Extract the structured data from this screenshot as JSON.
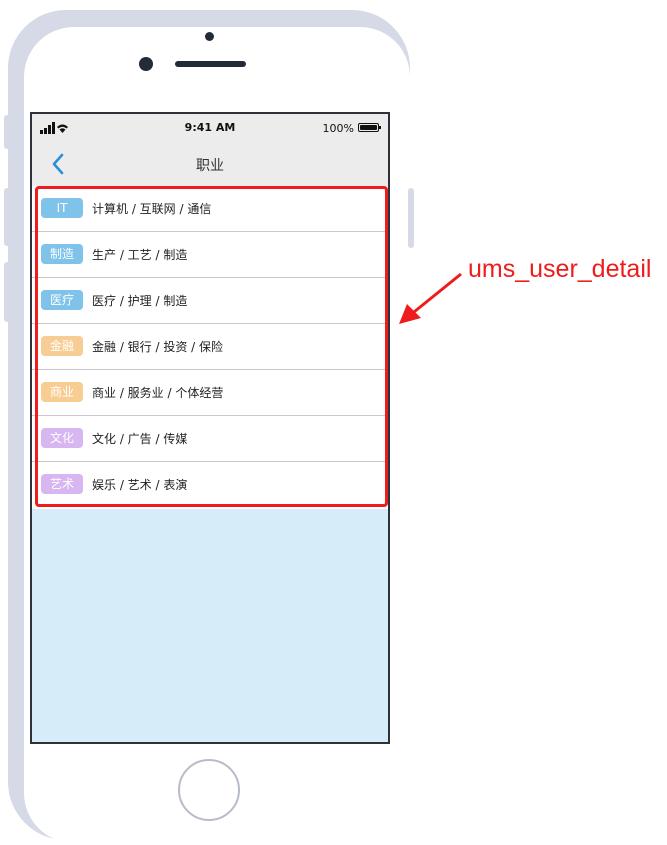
{
  "status_bar": {
    "time": "9:41 AM",
    "battery_text": "100%",
    "signal_icon": "signal-bars-icon",
    "wifi_icon": "wifi-icon",
    "battery_icon": "battery-icon"
  },
  "nav": {
    "title": "职业",
    "back_icon": "chevron-left-icon"
  },
  "categories": [
    {
      "tag": "IT",
      "label": "计算机 / 互联网 / 通信",
      "tag_color": "#7fc3ea"
    },
    {
      "tag": "制造",
      "label": "生产 / 工艺 / 制造",
      "tag_color": "#7fc3ea"
    },
    {
      "tag": "医疗",
      "label": "医疗 / 护理 / 制造",
      "tag_color": "#7fc3ea"
    },
    {
      "tag": "金融",
      "label": "金融 / 银行 / 投资 / 保险",
      "tag_color": "#f7cd93"
    },
    {
      "tag": "商业",
      "label": "商业 / 服务业 / 个体经营",
      "tag_color": "#f7cd93"
    },
    {
      "tag": "文化",
      "label": "文化 / 广告 / 传媒",
      "tag_color": "#d7b6f2"
    },
    {
      "tag": "艺术",
      "label": "娱乐 / 艺术 / 表演",
      "tag_color": "#d7b6f2"
    }
  ],
  "annotation": {
    "label": "ums_user_detail",
    "color": "#ee1c1c"
  },
  "colors": {
    "accent": "#2a8fd6",
    "screen_background": "#d6ecf8",
    "nav_background": "#ececec"
  }
}
